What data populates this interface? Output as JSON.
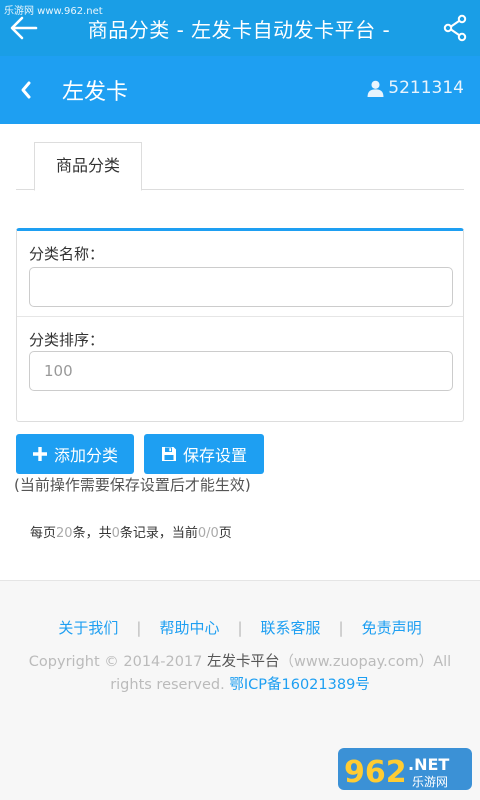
{
  "watermark_top": "乐游网 www.962.net",
  "appbar": {
    "title": "商品分类 - 左发卡自动发卡平台 -"
  },
  "header": {
    "name": "左发卡",
    "user_id": "5211314"
  },
  "tabs": [
    {
      "label": "商品分类"
    }
  ],
  "form": {
    "name_label": "分类名称：",
    "name_value": "",
    "sort_label": "分类排序：",
    "sort_value": "100"
  },
  "buttons": {
    "add": "添加分类",
    "save": "保存设置"
  },
  "note": "(当前操作需要保存设置后才能生效)",
  "pager": {
    "per_page_prefix": "每页",
    "per_page": "20",
    "per_page_suffix": "条，共",
    "total": "0",
    "total_suffix": "条记录，当前",
    "current": "0/0",
    "current_suffix": "页"
  },
  "footer": {
    "links": [
      "关于我们",
      "帮助中心",
      "联系客服",
      "免责声明"
    ],
    "copyright_prefix": "Copyright © 2014-2017 ",
    "brand": "左发卡平台",
    "copyright_mid": "（www.zuopay.com）All rights reserved. ",
    "icp": "鄂ICP备16021389号"
  },
  "watermark_corner": {
    "big": "962",
    "small": ".NET",
    "sub": "乐游网"
  },
  "colors": {
    "primary": "#1e9ff2",
    "appbar": "#1a9ee6"
  }
}
